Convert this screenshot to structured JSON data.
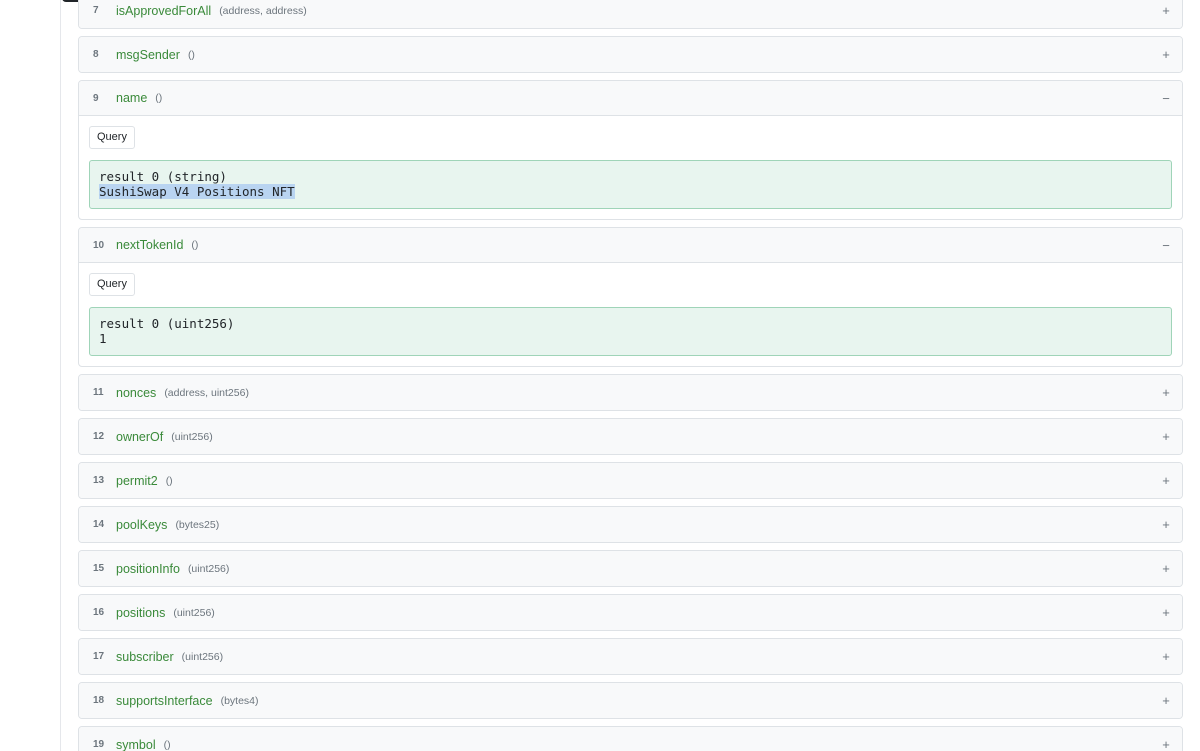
{
  "functions": [
    {
      "index": "7",
      "name": "isApprovedForAll",
      "params": "(address, address)",
      "toggle": "+"
    },
    {
      "index": "8",
      "name": "msgSender",
      "params": "()",
      "toggle": "+"
    },
    {
      "index": "9",
      "name": "name",
      "params": "()",
      "toggle": "−",
      "query_label": "Query",
      "result_header": "result 0 (string)",
      "result_value": "SushiSwap V4 Positions NFT"
    },
    {
      "index": "10",
      "name": "nextTokenId",
      "params": "()",
      "toggle": "−",
      "query_label": "Query",
      "result_header": "result 0 (uint256)",
      "result_value": "1"
    },
    {
      "index": "11",
      "name": "nonces",
      "params": "(address, uint256)",
      "toggle": "+"
    },
    {
      "index": "12",
      "name": "ownerOf",
      "params": "(uint256)",
      "toggle": "+"
    },
    {
      "index": "13",
      "name": "permit2",
      "params": "()",
      "toggle": "+"
    },
    {
      "index": "14",
      "name": "poolKeys",
      "params": "(bytes25)",
      "toggle": "+"
    },
    {
      "index": "15",
      "name": "positionInfo",
      "params": "(uint256)",
      "toggle": "+"
    },
    {
      "index": "16",
      "name": "positions",
      "params": "(uint256)",
      "toggle": "+"
    },
    {
      "index": "17",
      "name": "subscriber",
      "params": "(uint256)",
      "toggle": "+"
    },
    {
      "index": "18",
      "name": "supportsInterface",
      "params": "(bytes4)",
      "toggle": "+"
    },
    {
      "index": "19",
      "name": "symbol",
      "params": "()",
      "toggle": "+"
    }
  ],
  "colors": {
    "function_name": "#3a8a3a",
    "result_bg": "#e8f5ef",
    "result_border": "#9fd4b8",
    "selection": "#b9d4f1"
  }
}
